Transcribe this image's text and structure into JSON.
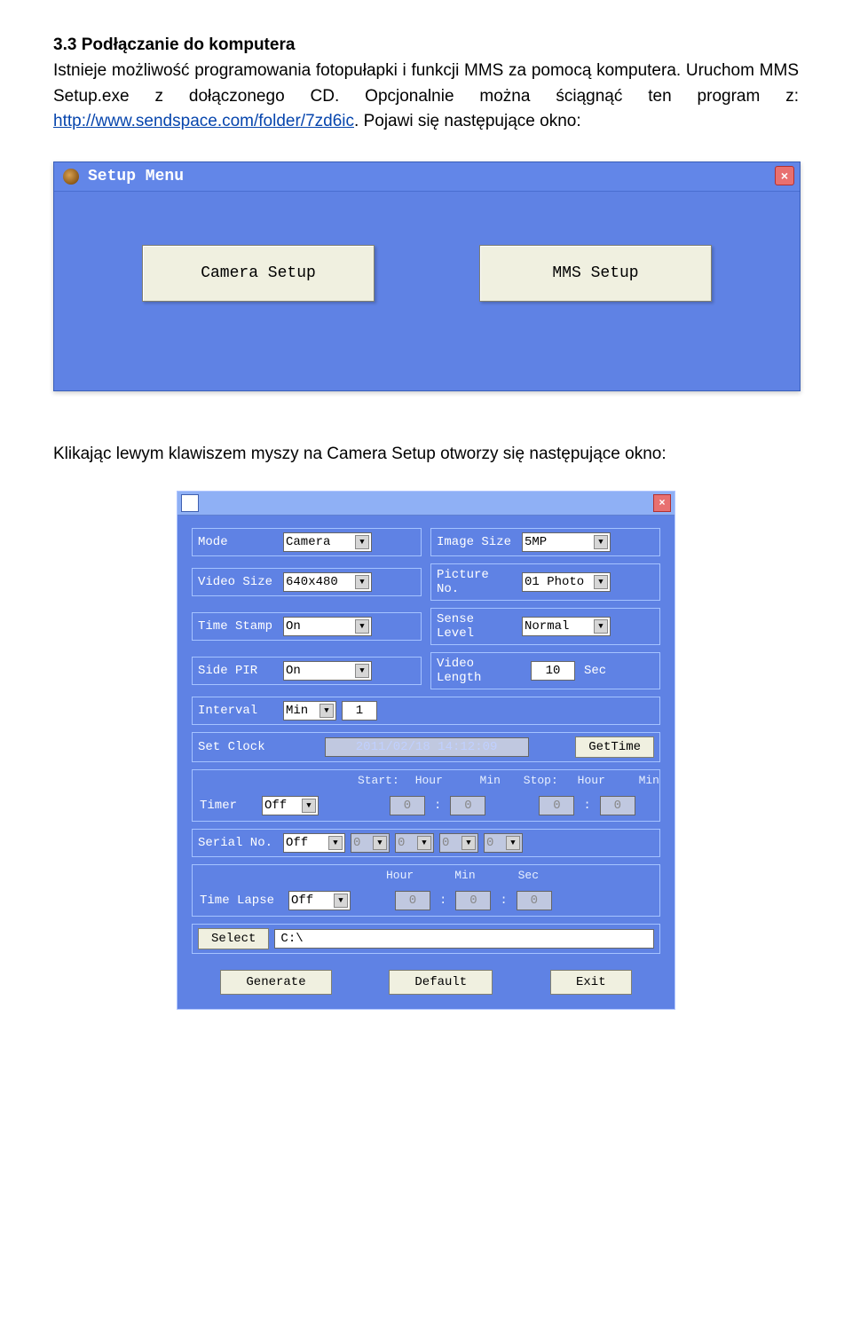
{
  "doc": {
    "heading": "3.3 Podłączanie do komputera",
    "para_a": "Istnieje możliwość programowania fotopułapki i funkcji MMS za pomocą komputera. Uruchom MMS Setup.exe z dołączonego CD. Opcjonalnie można ściągnąć ten program z: ",
    "link": "http://www.sendspace.com/folder/7zd6ic",
    "para_b": ". Pojawi się następujące okno:",
    "mid": "Klikając lewym klawiszem myszy na Camera Setup otworzy się następujące okno:"
  },
  "win1": {
    "title": "Setup Menu",
    "close": "×",
    "btn_camera": "Camera Setup",
    "btn_mms": "MMS Setup"
  },
  "win2": {
    "close": "×",
    "mode_lbl": "Mode",
    "mode_val": "Camera",
    "imgsize_lbl": "Image Size",
    "imgsize_val": "5MP",
    "vsize_lbl": "Video Size",
    "vsize_val": "640x480",
    "picno_lbl": "Picture No.",
    "picno_val": "01 Photo",
    "tstamp_lbl": "Time Stamp",
    "tstamp_val": "On",
    "sense_lbl": "Sense Level",
    "sense_val": "Normal",
    "sidepir_lbl": "Side PIR",
    "sidepir_val": "On",
    "vlen_lbl": "Video Length",
    "vlen_val": "10",
    "vlen_sec": "Sec",
    "interval_lbl": "Interval",
    "interval_unit": "Min",
    "interval_val": "1",
    "clock_lbl": "Set Clock",
    "clock_val": "2011/02/18 14:12:09",
    "gettime": "GetTime",
    "timer_header": {
      "start": "Start:",
      "hour": "Hour",
      "min": "Min",
      "stop": "Stop:"
    },
    "timer_lbl": "Timer",
    "timer_val": "Off",
    "timer_sh": "0",
    "timer_sm": "0",
    "timer_eh": "0",
    "timer_em": "0",
    "serial_lbl": "Serial No.",
    "serial_val": "Off",
    "serial_a": "0",
    "serial_b": "0",
    "serial_c": "0",
    "serial_d": "0",
    "tl_header": {
      "hour": "Hour",
      "min": "Min",
      "sec": "Sec"
    },
    "tl_lbl": "Time Lapse",
    "tl_val": "Off",
    "tl_h": "0",
    "tl_m": "0",
    "tl_s": "0",
    "select_lbl": "Select",
    "select_path": "C:\\",
    "btn_generate": "Generate",
    "btn_default": "Default",
    "btn_exit": "Exit"
  }
}
